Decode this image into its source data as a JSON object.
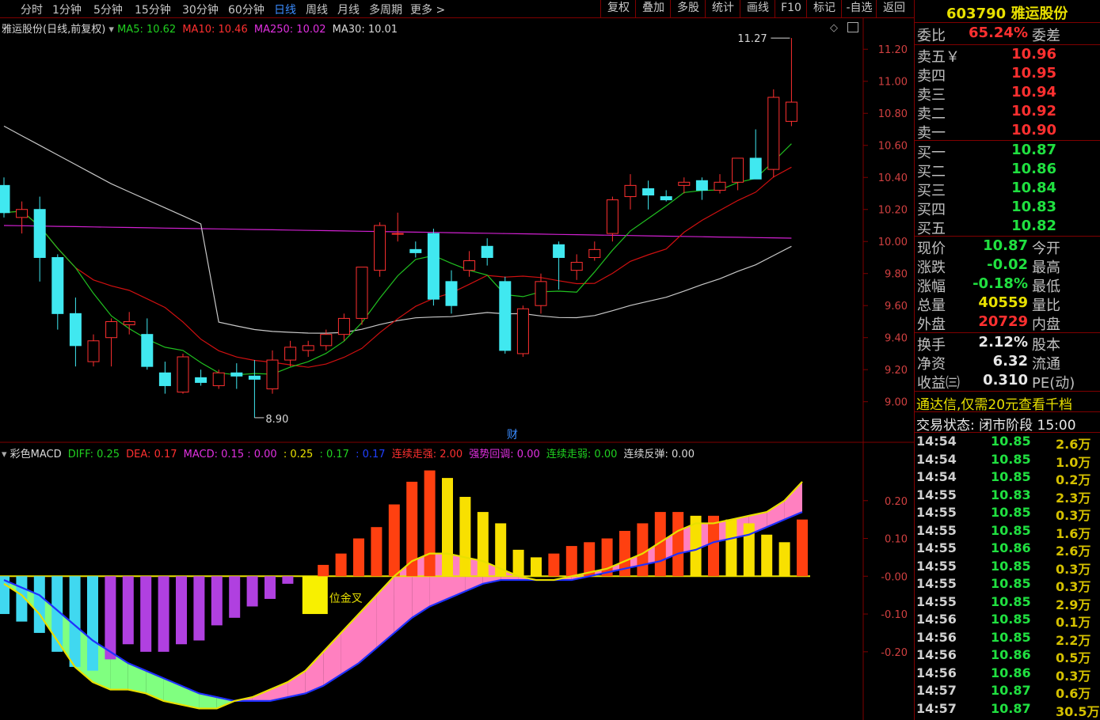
{
  "toolbar": {
    "periods": [
      "分时",
      "1分钟",
      "5分钟",
      "15分钟",
      "30分钟",
      "60分钟",
      "日线",
      "周线",
      "月线",
      "多周期",
      "更多 >"
    ],
    "active_period": "日线",
    "tools": [
      "复权",
      "叠加",
      "多股",
      "统计",
      "画线",
      "F10",
      "标记",
      "-自选",
      "返回"
    ]
  },
  "main_legend": {
    "title": "雅运股份(日线,前复权)",
    "ma5": "MA5: 10.62",
    "ma10": "MA10: 10.46",
    "ma250": "MA250: 10.02",
    "ma30": "MA30: 10.01"
  },
  "main_annotations": {
    "high_label": "11.27",
    "low_label": "8.90",
    "finance_marker": "财"
  },
  "sub_legend": {
    "title": "彩色MACD",
    "diff": "DIFF: 0.25",
    "dea": "DEA: 0.17",
    "macd": "MACD: 0.15",
    "v1": ": 0.00",
    "v2": ": 0.25",
    "v3": ": 0.17",
    "v4": ": 0.17",
    "lxzq": "连续走强: 2.00",
    "qshd": "强势回调: 0.00",
    "lxzr": "连续走弱: 0.00",
    "lxft": "连续反弹: 0.00",
    "cross_label": "位金叉"
  },
  "colors": {
    "up": "#ff3030",
    "down": "#40e8f0",
    "ma5": "#20c020",
    "ma10": "#d01010",
    "ma30": "#c8c8c8",
    "ma250": "#d020d0",
    "border": "#800000",
    "axis_text": "#d04040"
  },
  "chart_data": [
    {
      "type": "candlestick",
      "title": "雅运股份(日线,前复权)",
      "ylim": [
        8.88,
        11.3
      ],
      "y_ticks": [
        "11.20",
        "11.00",
        "10.80",
        "10.60",
        "10.40",
        "10.20",
        "10.00",
        "9.80",
        "9.60",
        "9.40",
        "9.20",
        "9.00"
      ],
      "ohlc": [
        [
          10.35,
          10.4,
          10.15,
          10.18
        ],
        [
          10.15,
          10.25,
          10.05,
          10.2
        ],
        [
          10.2,
          10.28,
          9.75,
          9.9
        ],
        [
          9.9,
          9.92,
          9.45,
          9.55
        ],
        [
          9.55,
          9.65,
          9.22,
          9.35
        ],
        [
          9.25,
          9.42,
          9.22,
          9.38
        ],
        [
          9.4,
          9.52,
          9.22,
          9.5
        ],
        [
          9.48,
          9.56,
          9.42,
          9.5
        ],
        [
          9.42,
          9.52,
          9.2,
          9.22
        ],
        [
          9.18,
          9.25,
          9.05,
          9.1
        ],
        [
          9.06,
          9.3,
          9.05,
          9.28
        ],
        [
          9.15,
          9.2,
          9.1,
          9.12
        ],
        [
          9.1,
          9.2,
          9.08,
          9.18
        ],
        [
          9.18,
          9.24,
          9.08,
          9.16
        ],
        [
          9.16,
          9.26,
          8.9,
          9.14
        ],
        [
          9.08,
          9.32,
          9.05,
          9.26
        ],
        [
          9.26,
          9.38,
          9.22,
          9.34
        ],
        [
          9.32,
          9.38,
          9.28,
          9.35
        ],
        [
          9.35,
          9.45,
          9.32,
          9.42
        ],
        [
          9.42,
          9.55,
          9.38,
          9.52
        ],
        [
          9.52,
          9.8,
          9.48,
          9.84
        ],
        [
          9.82,
          10.12,
          9.78,
          10.1
        ],
        [
          10.05,
          10.18,
          10.0,
          10.05
        ],
        [
          9.95,
          10.0,
          9.9,
          9.93
        ],
        [
          10.05,
          10.08,
          9.6,
          9.64
        ],
        [
          9.75,
          9.82,
          9.55,
          9.6
        ],
        [
          9.82,
          9.94,
          9.78,
          9.88
        ],
        [
          9.97,
          10.02,
          9.85,
          9.9
        ],
        [
          9.75,
          9.78,
          9.3,
          9.32
        ],
        [
          9.3,
          9.6,
          9.28,
          9.58
        ],
        [
          9.6,
          9.8,
          9.55,
          9.75
        ],
        [
          9.98,
          10.0,
          9.7,
          9.9
        ],
        [
          9.82,
          9.92,
          9.76,
          9.87
        ],
        [
          9.9,
          10.0,
          9.88,
          9.95
        ],
        [
          10.05,
          10.28,
          10.0,
          10.26
        ],
        [
          10.28,
          10.42,
          10.2,
          10.35
        ],
        [
          10.33,
          10.38,
          10.2,
          10.29
        ],
        [
          10.28,
          10.32,
          10.25,
          10.26
        ],
        [
          10.35,
          10.4,
          10.3,
          10.37
        ],
        [
          10.38,
          10.4,
          10.26,
          10.32
        ],
        [
          10.32,
          10.42,
          10.3,
          10.37
        ],
        [
          10.37,
          10.45,
          10.32,
          10.52
        ],
        [
          10.52,
          10.7,
          10.5,
          10.39
        ],
        [
          10.45,
          10.95,
          10.4,
          10.9
        ],
        [
          10.75,
          11.27,
          10.72,
          10.87
        ]
      ]
    },
    {
      "type": "bar",
      "title": "彩色MACD",
      "ylim": [
        -0.37,
        0.3
      ],
      "y_ticks": [
        "0.20",
        "0.10",
        "-0.00",
        "-0.10",
        "-0.20"
      ],
      "macd": [
        -0.1,
        -0.12,
        -0.15,
        -0.2,
        -0.24,
        -0.25,
        -0.22,
        -0.18,
        -0.2,
        -0.2,
        -0.18,
        -0.17,
        -0.13,
        -0.11,
        -0.08,
        -0.06,
        -0.02,
        -0.1,
        0.03,
        0.06,
        0.1,
        0.13,
        0.19,
        0.25,
        0.28,
        0.26,
        0.21,
        0.17,
        0.14,
        0.07,
        0.05,
        0.06,
        0.08,
        0.09,
        0.1,
        0.12,
        0.14,
        0.17,
        0.17,
        0.16,
        0.16,
        0.15,
        0.14,
        0.11,
        0.09,
        0.15
      ],
      "diff": [
        -0.02,
        -0.05,
        -0.1,
        -0.17,
        -0.24,
        -0.28,
        -0.3,
        -0.3,
        -0.31,
        -0.33,
        -0.34,
        -0.35,
        -0.35,
        -0.33,
        -0.32,
        -0.3,
        -0.28,
        -0.25,
        -0.2,
        -0.15,
        -0.1,
        -0.05,
        0.0,
        0.04,
        0.06,
        0.06,
        0.05,
        0.04,
        0.02,
        0.0,
        -0.01,
        -0.01,
        0.0,
        0.01,
        0.02,
        0.04,
        0.06,
        0.09,
        0.12,
        0.14,
        0.14,
        0.15,
        0.16,
        0.17,
        0.2,
        0.25
      ],
      "dea": [
        -0.01,
        -0.03,
        -0.05,
        -0.09,
        -0.13,
        -0.17,
        -0.2,
        -0.23,
        -0.25,
        -0.27,
        -0.29,
        -0.31,
        -0.32,
        -0.33,
        -0.33,
        -0.33,
        -0.32,
        -0.31,
        -0.29,
        -0.26,
        -0.23,
        -0.19,
        -0.15,
        -0.11,
        -0.08,
        -0.06,
        -0.04,
        -0.02,
        -0.01,
        -0.01,
        -0.01,
        -0.01,
        -0.01,
        0.0,
        0.01,
        0.02,
        0.03,
        0.04,
        0.06,
        0.07,
        0.09,
        0.1,
        0.11,
        0.13,
        0.15,
        0.17
      ]
    }
  ],
  "panel": {
    "code": "603790",
    "name": "雅运股份",
    "weibi_label": "委比",
    "weibi_value": "65.24%",
    "weicha_label": "委差",
    "asks": [
      {
        "label": "卖五￥",
        "price": "10.96"
      },
      {
        "label": "卖四",
        "price": "10.95"
      },
      {
        "label": "卖三",
        "price": "10.94"
      },
      {
        "label": "卖二",
        "price": "10.92"
      },
      {
        "label": "卖一",
        "price": "10.90"
      }
    ],
    "bids": [
      {
        "label": "买一",
        "price": "10.87"
      },
      {
        "label": "买二",
        "price": "10.86"
      },
      {
        "label": "买三",
        "price": "10.84"
      },
      {
        "label": "买四",
        "price": "10.83"
      },
      {
        "label": "买五",
        "price": "10.82"
      }
    ],
    "stats": [
      {
        "label": "现价",
        "value": "10.87",
        "label2": "今开",
        "color": "green"
      },
      {
        "label": "涨跌",
        "value": "-0.02",
        "label2": "最高",
        "color": "green"
      },
      {
        "label": "涨幅",
        "value": "-0.18%",
        "label2": "最低",
        "color": "green"
      },
      {
        "label": "总量",
        "value": "40559",
        "label2": "量比",
        "color": "yellow"
      },
      {
        "label": "外盘",
        "value": "20729",
        "label2": "内盘",
        "color": "red"
      }
    ],
    "stats2": [
      {
        "label": "换手",
        "value": "2.12%",
        "label2": "股本",
        "color": "white"
      },
      {
        "label": "净资",
        "value": "6.32",
        "label2": "流通",
        "color": "white"
      },
      {
        "label": "收益㈢",
        "value": "0.310",
        "label2": "PE(动)",
        "color": "white"
      }
    ],
    "ad_text": "通达信,仅需20元查看千档",
    "trade_status": "交易状态: 闭市阶段 15:00",
    "ticks": [
      {
        "time": "14:54",
        "price": "10.85",
        "vol": "2.6万"
      },
      {
        "time": "14:54",
        "price": "10.85",
        "vol": "1.0万"
      },
      {
        "time": "14:54",
        "price": "10.85",
        "vol": "0.2万"
      },
      {
        "time": "14:55",
        "price": "10.83",
        "vol": "2.3万"
      },
      {
        "time": "14:55",
        "price": "10.85",
        "vol": "0.3万"
      },
      {
        "time": "14:55",
        "price": "10.85",
        "vol": "1.6万"
      },
      {
        "time": "14:55",
        "price": "10.86",
        "vol": "2.6万"
      },
      {
        "time": "14:55",
        "price": "10.85",
        "vol": "0.3万"
      },
      {
        "time": "14:55",
        "price": "10.85",
        "vol": "0.3万"
      },
      {
        "time": "14:55",
        "price": "10.85",
        "vol": "2.9万"
      },
      {
        "time": "14:56",
        "price": "10.85",
        "vol": "0.1万"
      },
      {
        "time": "14:56",
        "price": "10.85",
        "vol": "2.2万"
      },
      {
        "time": "14:56",
        "price": "10.86",
        "vol": "0.5万"
      },
      {
        "time": "14:56",
        "price": "10.86",
        "vol": "0.3万"
      },
      {
        "time": "14:57",
        "price": "10.87",
        "vol": "0.6万"
      },
      {
        "time": "14:57",
        "price": "10.87",
        "vol": "30.5万"
      }
    ]
  }
}
